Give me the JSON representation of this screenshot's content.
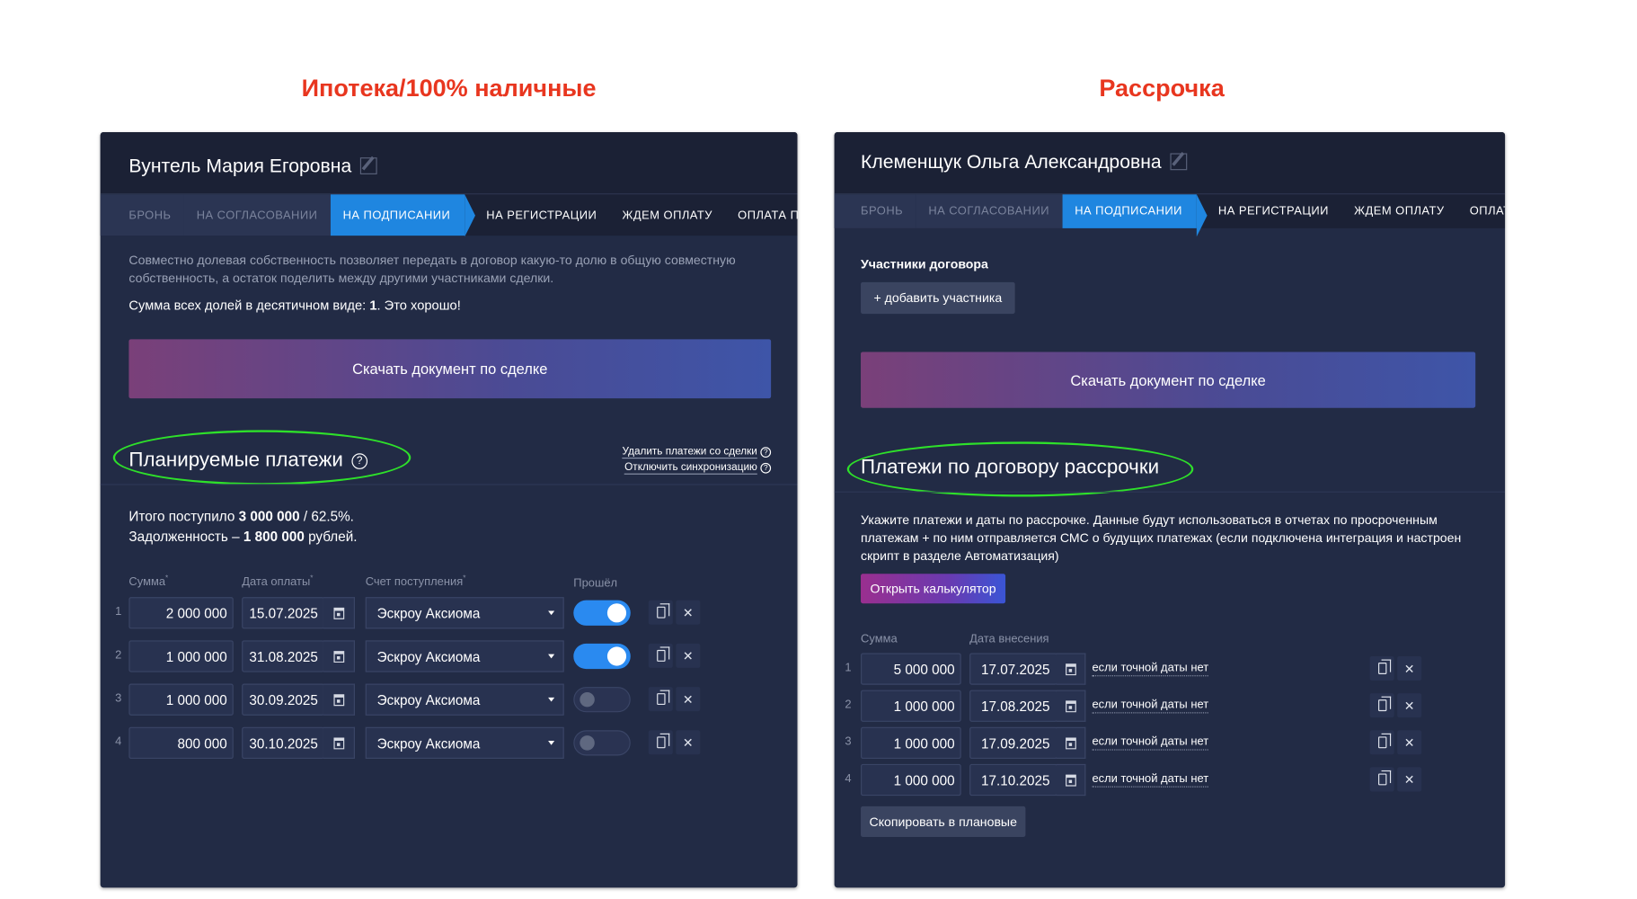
{
  "captions": {
    "left": "Ипотека/100% наличные",
    "right": "Рассрочка"
  },
  "stages": [
    "БРОНЬ",
    "НА СОГЛАСОВАНИИ",
    "НА ПОДПИСАНИИ",
    "НА РЕГИСТРАЦИИ",
    "ЖДЕМ ОПЛАТУ",
    "ОПЛАТА ПОЛУ"
  ],
  "left": {
    "name": "Вунтель Мария Егоровна",
    "info": "Совместно долевая собственность позволяет передать в договор какую-то долю в общую совместную собственность, а остаток поделить между другими участниками сделки.",
    "sum_prefix": "Сумма всех долей в десятичном виде: ",
    "sum_value": "1",
    "sum_suffix": ". Это хорошо!",
    "download": "Скачать документ по сделке",
    "section_title": "Планируемые платежи",
    "delete_link": "Удалить платежи со сделки",
    "sync_link": "Отключить синхронизацию",
    "total_prefix": "Итого поступило ",
    "total_value": "3 000 000",
    "total_suffix": " / 62.5%.",
    "debt_prefix": "Задолженность – ",
    "debt_value": "1 800 000",
    "debt_suffix": " рублей.",
    "headers": {
      "sum": "Сумма",
      "date": "Дата оплаты",
      "account": "Счет поступления",
      "passed": "Прошёл",
      "req": "*"
    },
    "rows": [
      {
        "n": "1",
        "sum": "2 000 000",
        "date": "15.07.2025",
        "account": "Эскроу Аксиома",
        "passed": true
      },
      {
        "n": "2",
        "sum": "1 000 000",
        "date": "31.08.2025",
        "account": "Эскроу Аксиома",
        "passed": true
      },
      {
        "n": "3",
        "sum": "1 000 000",
        "date": "30.09.2025",
        "account": "Эскроу Аксиома",
        "passed": false
      },
      {
        "n": "4",
        "sum": "800 000",
        "date": "30.10.2025",
        "account": "Эскроу Аксиома",
        "passed": false
      }
    ]
  },
  "right": {
    "name": "Клеменщук Ольга Александровна",
    "participants_label": "Участники договора",
    "add_participant": "+ добавить участника",
    "download": "Скачать документ по сделке",
    "section_title": "Платежи по договору рассрочки",
    "info": "Укажите платежи и даты по рассрочке. Данные будут использоваться в отчетах по просроченным платежам + по ним отправляется СМС о будущих платежах (если подключена интеграция и настроен скрипт в разделе Автоматизация)",
    "calculator": "Открыть калькулятор",
    "headers": {
      "sum": "Сумма",
      "date": "Дата внесения"
    },
    "no_date_link": "если точной даты нет",
    "rows": [
      {
        "n": "1",
        "sum": "5 000 000",
        "date": "17.07.2025"
      },
      {
        "n": "2",
        "sum": "1 000 000",
        "date": "17.08.2025"
      },
      {
        "n": "3",
        "sum": "1 000 000",
        "date": "17.09.2025"
      },
      {
        "n": "4",
        "sum": "1 000 000",
        "date": "17.10.2025"
      }
    ],
    "copy_to_planned": "Скопировать в плановые"
  }
}
